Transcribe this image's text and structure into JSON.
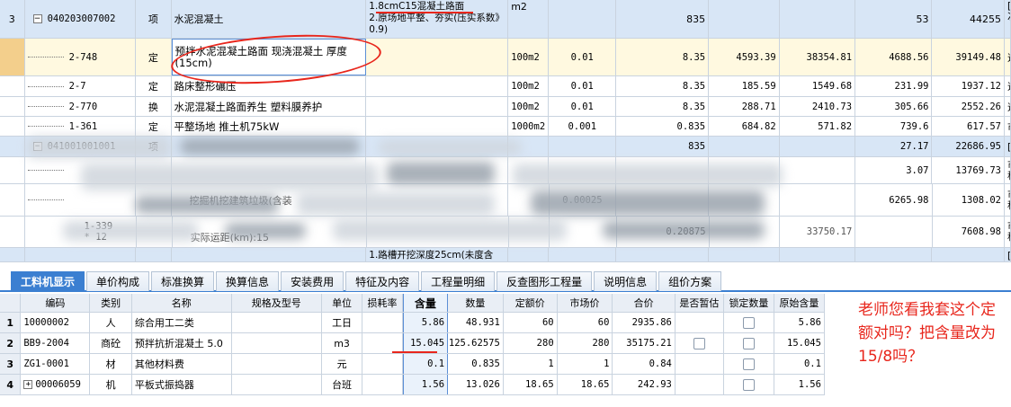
{
  "upper_rows": {
    "r1": {
      "num": "3",
      "code": "040203007002",
      "type": "项",
      "name": "水泥混凝土",
      "feature": "1.8cmC15混凝土路面\n2.原场地平整、夯实(压实系数》0.9)",
      "unit": "m2",
      "c6": "",
      "c7": "835",
      "c8": "",
      "c9": "",
      "c10": "53",
      "c11": "44255",
      "c12": "[市\n次"
    },
    "r2": {
      "code": "2-748",
      "type": "定",
      "name": "预拌水泥混凝土路面 现浇混凝土 厚度(15cm)",
      "unit": "100m2",
      "c6": "0.01",
      "c7": "8.35",
      "c8": "4593.39",
      "c9": "38354.81",
      "c10": "4688.56",
      "c11": "39149.48",
      "c12": "道"
    },
    "r3": {
      "code": "2-7",
      "type": "定",
      "name": "路床整形碾压",
      "unit": "100m2",
      "c6": "0.01",
      "c7": "8.35",
      "c8": "185.59",
      "c9": "1549.68",
      "c10": "231.99",
      "c11": "1937.12",
      "c12": "道"
    },
    "r4": {
      "code": "2-770",
      "type": "换",
      "name": "水泥混凝土路面养生 塑料膜养护",
      "unit": "100m2",
      "c6": "0.01",
      "c7": "8.35",
      "c8": "288.71",
      "c9": "2410.73",
      "c10": "305.66",
      "c11": "2552.26",
      "c12": "道"
    },
    "r5": {
      "code": "1-361",
      "type": "定",
      "name": "平整场地 推土机75kW",
      "unit": "1000m2",
      "c6": "0.001",
      "c7": "0.835",
      "c8": "684.82",
      "c9": "571.82",
      "c10": "739.6",
      "c11": "617.57",
      "c12": "市"
    },
    "r6": {
      "code": "041001001001",
      "type": "项",
      "c7": "835",
      "c10": "27.17",
      "c11": "22686.95",
      "c12": "[市"
    },
    "r7": {
      "c10": "3.07",
      "c11": "13769.73",
      "c12": "市\n程"
    },
    "r8": {
      "name_frag": "挖掘机挖建筑垃圾(含装",
      "c6": "0.00025",
      "c10": "6265.98",
      "c11": "1308.02",
      "c12": "市\n程"
    },
    "r9": {
      "code": "1-339\n* 12",
      "name_frag": "实际运距(km):15",
      "c7": "0.20875",
      "c9": "33750.17",
      "c11": "7608.98",
      "c12": "市\n程"
    },
    "r10": {
      "feature": "1.路槽开挖深度25cm(未度含",
      "c12": "[市"
    }
  },
  "tabs": [
    "工料机显示",
    "单价构成",
    "标准换算",
    "换算信息",
    "安装费用",
    "特征及内容",
    "工程量明细",
    "反查图形工程量",
    "说明信息",
    "组价方案"
  ],
  "lower_headers": [
    "编码",
    "类别",
    "名称",
    "规格及型号",
    "单位",
    "损耗率",
    "含量",
    "数量",
    "定额价",
    "市场价",
    "合价",
    "是否暂估",
    "锁定数量",
    "原始含量"
  ],
  "lower_rows": [
    {
      "idx": "1",
      "code": "10000002",
      "cat": "人",
      "name": "综合用工二类",
      "spec": "",
      "unit": "工日",
      "loss": "",
      "qty": "5.86",
      "amount": "48.931",
      "quota": "60",
      "market": "60",
      "total": "2935.86",
      "est": false,
      "lock": true,
      "orig": "5.86"
    },
    {
      "idx": "2",
      "code": "BB9-2004",
      "cat": "商砼",
      "name": "预拌抗折混凝土 5.0",
      "spec": "",
      "unit": "m3",
      "loss": "",
      "qty": "15.045",
      "amount": "125.62575",
      "quota": "280",
      "market": "280",
      "total": "35175.21",
      "est": true,
      "lock": true,
      "orig": "15.045"
    },
    {
      "idx": "3",
      "code": "ZG1-0001",
      "cat": "材",
      "name": "其他材料费",
      "spec": "",
      "unit": "元",
      "loss": "",
      "qty": "0.1",
      "amount": "0.835",
      "quota": "1",
      "market": "1",
      "total": "0.84",
      "est": false,
      "lock": true,
      "orig": "0.1"
    },
    {
      "idx": "4",
      "code": "00006059",
      "cat": "机",
      "name": "平板式振捣器",
      "spec": "",
      "unit": "台班",
      "loss": "",
      "qty": "1.56",
      "amount": "13.026",
      "quota": "18.65",
      "market": "18.65",
      "total": "242.93",
      "est": false,
      "lock": true,
      "orig": "1.56"
    }
  ],
  "comment": "老师您看我套这个定额对吗？把含量改为15/8吗？",
  "colors": {
    "accent": "#3b7fd1",
    "annotation": "#e8261c"
  }
}
